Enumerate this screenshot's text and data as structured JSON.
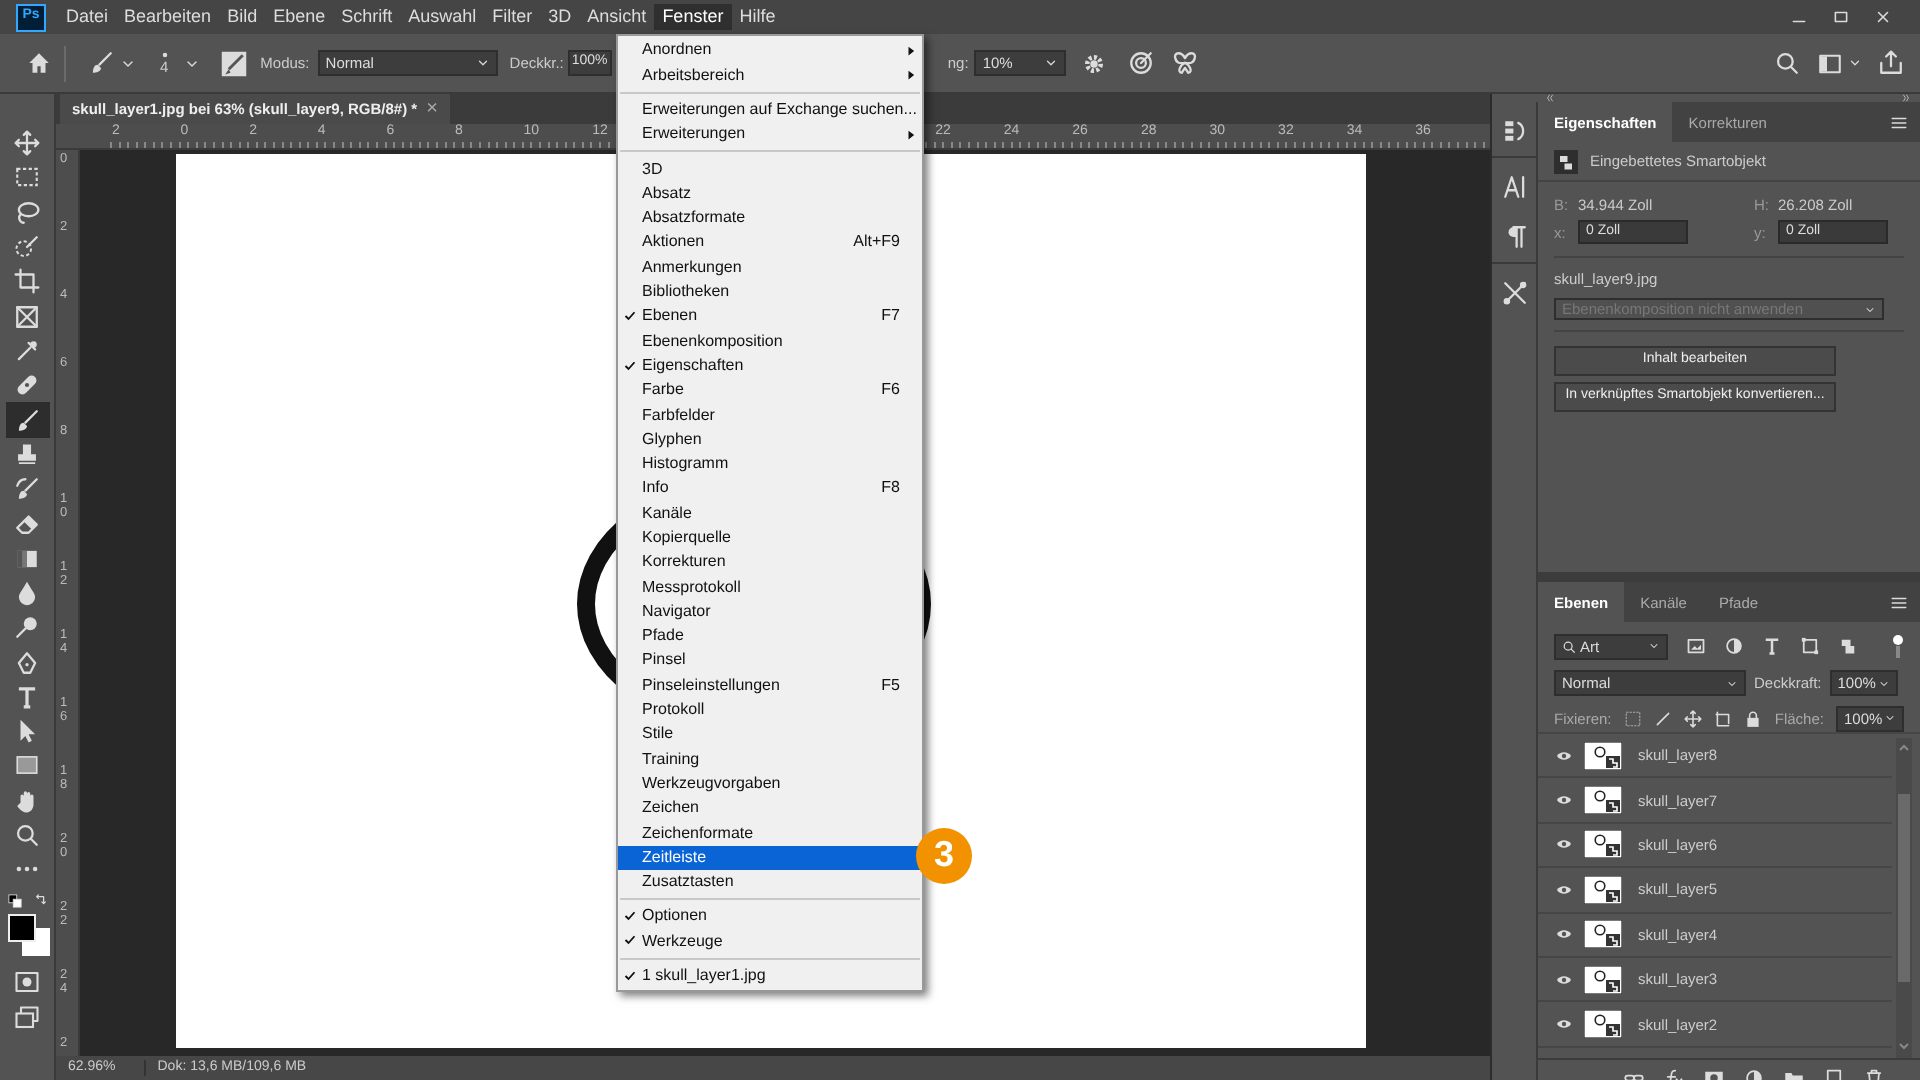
{
  "app_logo": "Ps",
  "menu_bar": [
    {
      "label": "Datei",
      "selected": false
    },
    {
      "label": "Bearbeiten",
      "selected": false
    },
    {
      "label": "Bild",
      "selected": false
    },
    {
      "label": "Ebene",
      "selected": false
    },
    {
      "label": "Schrift",
      "selected": false
    },
    {
      "label": "Auswahl",
      "selected": false
    },
    {
      "label": "Filter",
      "selected": false
    },
    {
      "label": "3D",
      "selected": false
    },
    {
      "label": "Ansicht",
      "selected": false
    },
    {
      "label": "Fenster",
      "selected": true
    },
    {
      "label": "Hilfe",
      "selected": false
    }
  ],
  "options_bar": {
    "brush_size": "4",
    "mode_label": "Modus:",
    "mode_value": "Normal",
    "opacity_label": "Deckkr.:",
    "opacity_value": "100%",
    "smoothing_label": "ng:",
    "smoothing_value": "10%"
  },
  "document_tab": {
    "title": "skull_layer1.jpg bei 63% (skull_layer9, RGB/8#) *",
    "close": "×"
  },
  "top_ruler": {
    "left_labels": [
      "2",
      "0",
      "2",
      "4",
      "6",
      "8",
      "10",
      "12"
    ],
    "right_labels": [
      "22",
      "24",
      "26",
      "28",
      "30",
      "32",
      "34",
      "36"
    ]
  },
  "left_ruler": [
    "0",
    "2",
    "4",
    "6",
    "8",
    "10",
    "12",
    "14",
    "16",
    "18",
    "20",
    "22",
    "24",
    "2"
  ],
  "tools": [
    {
      "kind": "move",
      "selected": false
    },
    {
      "kind": "marquee",
      "selected": false
    },
    {
      "kind": "lasso",
      "selected": false
    },
    {
      "kind": "quick",
      "selected": false
    },
    {
      "kind": "crop",
      "selected": false
    },
    {
      "kind": "frame",
      "selected": false
    },
    {
      "kind": "eyedropper",
      "selected": false
    },
    {
      "kind": "heal",
      "selected": false
    },
    {
      "kind": "brush",
      "selected": true
    },
    {
      "kind": "stamp",
      "selected": false
    },
    {
      "kind": "history",
      "selected": false
    },
    {
      "kind": "eraser",
      "selected": false
    },
    {
      "kind": "gradient",
      "selected": false
    },
    {
      "kind": "blur",
      "selected": false
    },
    {
      "kind": "dodge",
      "selected": false
    },
    {
      "kind": "pen",
      "selected": false
    },
    {
      "kind": "type",
      "selected": false
    },
    {
      "kind": "select",
      "selected": false
    },
    {
      "kind": "shape",
      "selected": false
    },
    {
      "kind": "hand",
      "selected": false
    },
    {
      "kind": "zoom",
      "selected": false
    },
    {
      "kind": "more",
      "selected": false
    }
  ],
  "color_swatches": [
    {
      "kind": "foreground",
      "color": "#000000"
    },
    {
      "kind": "background",
      "color": "#ffffff"
    }
  ],
  "status_bar": {
    "zoom": "62.96%",
    "doc_size": "Dok: 13,6 MB/109,6 MB"
  },
  "window_menu": {
    "groups": [
      [
        {
          "label": "Anordnen",
          "checked": false,
          "selected": false,
          "submenu": true
        },
        {
          "label": "Arbeitsbereich",
          "checked": false,
          "selected": false,
          "submenu": true
        }
      ],
      [
        {
          "label": "Erweiterungen auf Exchange suchen...",
          "checked": false,
          "selected": false
        },
        {
          "label": "Erweiterungen",
          "checked": false,
          "selected": false,
          "submenu": true
        }
      ],
      [
        {
          "label": "3D",
          "checked": false,
          "selected": false
        },
        {
          "label": "Absatz",
          "checked": false,
          "selected": false
        },
        {
          "label": "Absatzformate",
          "checked": false,
          "selected": false
        },
        {
          "label": "Aktionen",
          "checked": false,
          "selected": false,
          "shortcut": "Alt+F9"
        },
        {
          "label": "Anmerkungen",
          "checked": false,
          "selected": false
        },
        {
          "label": "Bibliotheken",
          "checked": false,
          "selected": false
        },
        {
          "label": "Ebenen",
          "checked": true,
          "selected": false,
          "shortcut": "F7"
        },
        {
          "label": "Ebenenkomposition",
          "checked": false,
          "selected": false
        },
        {
          "label": "Eigenschaften",
          "checked": true,
          "selected": false
        },
        {
          "label": "Farbe",
          "checked": false,
          "selected": false,
          "shortcut": "F6"
        },
        {
          "label": "Farbfelder",
          "checked": false,
          "selected": false
        },
        {
          "label": "Glyphen",
          "checked": false,
          "selected": false
        },
        {
          "label": "Histogramm",
          "checked": false,
          "selected": false
        },
        {
          "label": "Info",
          "checked": false,
          "selected": false,
          "shortcut": "F8"
        },
        {
          "label": "Kanäle",
          "checked": false,
          "selected": false
        },
        {
          "label": "Kopierquelle",
          "checked": false,
          "selected": false
        },
        {
          "label": "Korrekturen",
          "checked": false,
          "selected": false
        },
        {
          "label": "Messprotokoll",
          "checked": false,
          "selected": false
        },
        {
          "label": "Navigator",
          "checked": false,
          "selected": false
        },
        {
          "label": "Pfade",
          "checked": false,
          "selected": false
        },
        {
          "label": "Pinsel",
          "checked": false,
          "selected": false
        },
        {
          "label": "Pinseleinstellungen",
          "checked": false,
          "selected": false,
          "shortcut": "F5"
        },
        {
          "label": "Protokoll",
          "checked": false,
          "selected": false
        },
        {
          "label": "Stile",
          "checked": false,
          "selected": false
        },
        {
          "label": "Training",
          "checked": false,
          "selected": false
        },
        {
          "label": "Werkzeugvorgaben",
          "checked": false,
          "selected": false
        },
        {
          "label": "Zeichen",
          "checked": false,
          "selected": false
        },
        {
          "label": "Zeichenformate",
          "checked": false,
          "selected": false
        },
        {
          "label": "Zeitleiste",
          "checked": false,
          "selected": true
        },
        {
          "label": "Zusatztasten",
          "checked": false,
          "selected": false
        }
      ],
      [
        {
          "label": "Optionen",
          "checked": true,
          "selected": false
        },
        {
          "label": "Werkzeuge",
          "checked": true,
          "selected": false
        }
      ],
      [
        {
          "label": "1 skull_layer1.jpg",
          "checked": true,
          "selected": false
        }
      ]
    ]
  },
  "step_badge": "3",
  "properties_panel": {
    "tabs": [
      {
        "label": "Eigenschaften",
        "selected": true
      },
      {
        "label": "Korrekturen",
        "selected": false
      }
    ],
    "object_type": "Eingebettetes Smartobjekt",
    "width_label": "B:",
    "width_value": "34.944 Zoll",
    "height_label": "H:",
    "height_value": "26.208 Zoll",
    "x_label": "x:",
    "x_value": "0 Zoll",
    "y_label": "y:",
    "y_value": "0 Zoll",
    "file_name": "skull_layer9.jpg",
    "comp_dropdown": {
      "value": "Ebenenkomposition nicht anwenden",
      "disabled": true
    },
    "buttons": [
      "Inhalt bearbeiten",
      "In verknüpftes Smartobjekt konvertieren..."
    ]
  },
  "layers_panel": {
    "tabs": [
      {
        "label": "Ebenen",
        "selected": true
      },
      {
        "label": "Kanäle",
        "selected": false
      },
      {
        "label": "Pfade",
        "selected": false
      }
    ],
    "filter_value": "Art",
    "blend_mode": "Normal",
    "opacity_label": "Deckkraft:",
    "opacity_value": "100%",
    "lock_label": "Fixieren:",
    "fill_label": "Fläche:",
    "fill_value": "100%",
    "layers": [
      {
        "name": "skull_layer8",
        "visible": true,
        "selected": false
      },
      {
        "name": "skull_layer7",
        "visible": true,
        "selected": false
      },
      {
        "name": "skull_layer6",
        "visible": true,
        "selected": false
      },
      {
        "name": "skull_layer5",
        "visible": true,
        "selected": false
      },
      {
        "name": "skull_layer4",
        "visible": true,
        "selected": false
      },
      {
        "name": "skull_layer3",
        "visible": true,
        "selected": false
      },
      {
        "name": "skull_layer2",
        "visible": true,
        "selected": false
      }
    ]
  }
}
